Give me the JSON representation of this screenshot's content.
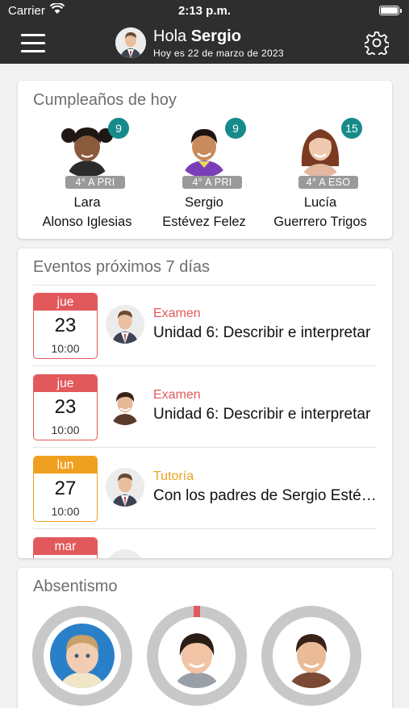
{
  "status_bar": {
    "carrier": "Carrier",
    "time": "2:13 p.m."
  },
  "header": {
    "greeting": "Hola",
    "user_name": "Sergio",
    "date_text": "Hoy es 22 de marzo de 2023",
    "menu_icon": "hamburger-menu-icon",
    "settings_icon": "gear-icon"
  },
  "birthdays": {
    "title": "Cumpleaños de hoy",
    "students": [
      {
        "first_name": "Lara",
        "last_name": "Alonso Iglesias",
        "age": "9",
        "course": "4° A PRI"
      },
      {
        "first_name": "Sergio",
        "last_name": "Estévez Felez",
        "age": "9",
        "course": "4° A PRI"
      },
      {
        "first_name": "Lucía",
        "last_name": "Guerrero Trigos",
        "age": "15",
        "course": "4° A ESO"
      }
    ]
  },
  "events": {
    "title": "Eventos próximos 7 días",
    "items": [
      {
        "weekday": "jue",
        "day": "23",
        "time": "10:00",
        "type": "Examen",
        "description": "Unidad 6: Describir e interpretar",
        "color": "#e2595b"
      },
      {
        "weekday": "jue",
        "day": "23",
        "time": "10:00",
        "type": "Examen",
        "description": "Unidad 6: Describir e interpretar",
        "color": "#e2595b"
      },
      {
        "weekday": "lun",
        "day": "27",
        "time": "10:00",
        "type": "Tutoría",
        "description": "Con los padres de Sergio Estévez",
        "color": "#f0a020"
      },
      {
        "weekday": "mar",
        "day": "",
        "time": "",
        "type": "",
        "description": "",
        "color": "#e2595b"
      }
    ]
  },
  "absentismo": {
    "title": "Absentismo",
    "students": [
      {
        "value": "0"
      },
      {
        "value": "1"
      },
      {
        "value": "0"
      }
    ]
  },
  "colors": {
    "header_bg": "#2e2e2e",
    "accent_teal": "#168b8a",
    "exam_red": "#e2595b",
    "tutoria_orange": "#f0a020"
  }
}
